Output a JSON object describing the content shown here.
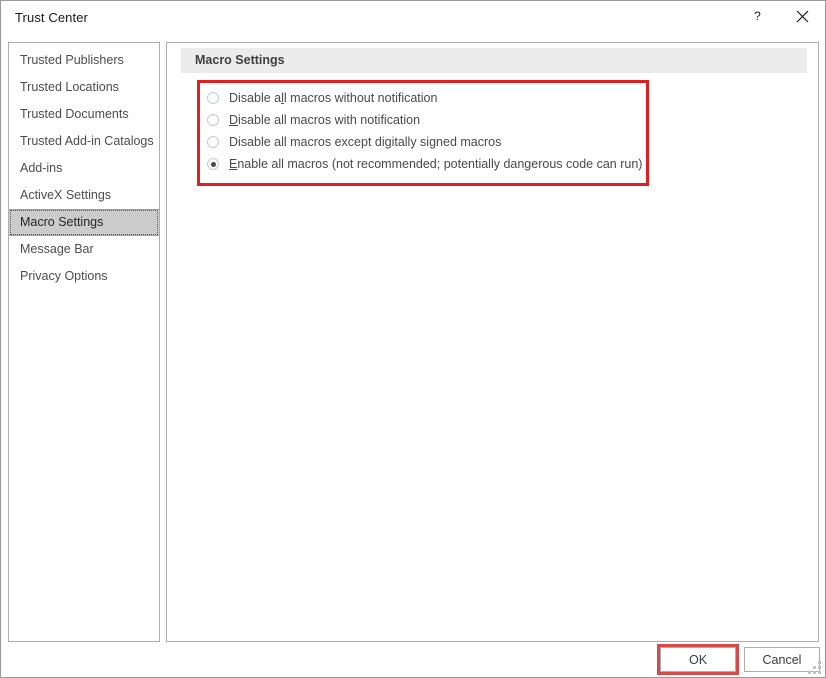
{
  "window": {
    "title": "Trust Center",
    "help_icon": "help-question-icon",
    "close_icon": "close-icon"
  },
  "sidebar": {
    "items": [
      {
        "label": "Trusted Publishers",
        "selected": false
      },
      {
        "label": "Trusted Locations",
        "selected": false
      },
      {
        "label": "Trusted Documents",
        "selected": false
      },
      {
        "label": "Trusted Add-in Catalogs",
        "selected": false
      },
      {
        "label": "Add-ins",
        "selected": false
      },
      {
        "label": "ActiveX Settings",
        "selected": false
      },
      {
        "label": "Macro Settings",
        "selected": true
      },
      {
        "label": "Message Bar",
        "selected": false
      },
      {
        "label": "Privacy Options",
        "selected": false
      }
    ]
  },
  "main": {
    "section_title": "Macro Settings",
    "options": [
      {
        "label": "Disable all macros without notification",
        "accel_before": "Disable a",
        "accel": "l",
        "accel_after": "l macros without notification",
        "checked": false
      },
      {
        "label": "Disable all macros with notification",
        "accel_before": "",
        "accel": "D",
        "accel_after": "isable all macros with notification",
        "checked": false
      },
      {
        "label": "Disable all macros except digitally signed macros",
        "accel_before": "Disable all macros except di",
        "accel": "g",
        "accel_after": "itally signed macros",
        "checked": false
      },
      {
        "label": "Enable all macros (not recommended; potentially dangerous code can run)",
        "accel_before": "",
        "accel": "E",
        "accel_after": "nable all macros (not recommended; potentially dangerous code can run)",
        "checked": true
      }
    ]
  },
  "footer": {
    "ok_label": "OK",
    "cancel_label": "Cancel"
  },
  "annotations": {
    "highlight_color": "#e02020",
    "button_highlight_color": "#d74a4a"
  }
}
